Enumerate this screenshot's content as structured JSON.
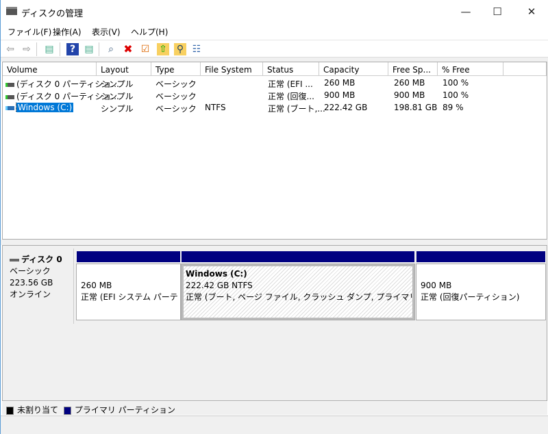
{
  "window": {
    "title": "ディスクの管理",
    "minimize": "—",
    "maximize": "☐",
    "close": "✕"
  },
  "menu": [
    "ファイル(F)",
    "操作(A)",
    "表示(V)",
    "ヘルプ(H)"
  ],
  "toolbar": {
    "back": "⇦",
    "forward": "⇨",
    "panel": "▤",
    "help": "?",
    "panel2": "▤",
    "connect": "⌕",
    "delete": "✖",
    "properties": "☑",
    "folder_up": "⇧",
    "folder_search": "⚲",
    "list": "☷"
  },
  "columns": [
    "Volume",
    "Layout",
    "Type",
    "File System",
    "Status",
    "Capacity",
    "Free Sp...",
    "% Free"
  ],
  "rows": [
    {
      "volume": "(ディスク 0 パーティショ...",
      "layout": "シンプル",
      "type": "ベーシック",
      "fs": "",
      "status": "正常 (EFI ...",
      "capacity": "260 MB",
      "free": "260 MB",
      "pct": "100 %"
    },
    {
      "volume": "(ディスク 0 パーティショ...",
      "layout": "シンプル",
      "type": "ベーシック",
      "fs": "",
      "status": "正常 (回復...",
      "capacity": "900 MB",
      "free": "900 MB",
      "pct": "100 %"
    },
    {
      "volume": "Windows (C:)",
      "layout": "シンプル",
      "type": "ベーシック",
      "fs": "NTFS",
      "status": "正常 (ブート,...",
      "capacity": "222.42 GB",
      "free": "198.81 GB",
      "pct": "89 %"
    }
  ],
  "disk": {
    "name": "ディスク 0",
    "type": "ベーシック",
    "size": "223.56 GB",
    "state": "オンライン"
  },
  "partitions": [
    {
      "name": "",
      "size": "260 MB",
      "status": "正常 (EFI システム パーティション)"
    },
    {
      "name": "Windows  (C:)",
      "size": "222.42 GB NTFS",
      "status": "正常 (ブート, ページ ファイル, クラッシュ ダンプ, プライマリ パーティション)"
    },
    {
      "name": "",
      "size": "900 MB",
      "status": "正常 (回復パーティション)"
    }
  ],
  "legend": [
    {
      "label": "未割り当て",
      "color": "#000000"
    },
    {
      "label": "プライマリ パーティション",
      "color": "#000080"
    }
  ]
}
